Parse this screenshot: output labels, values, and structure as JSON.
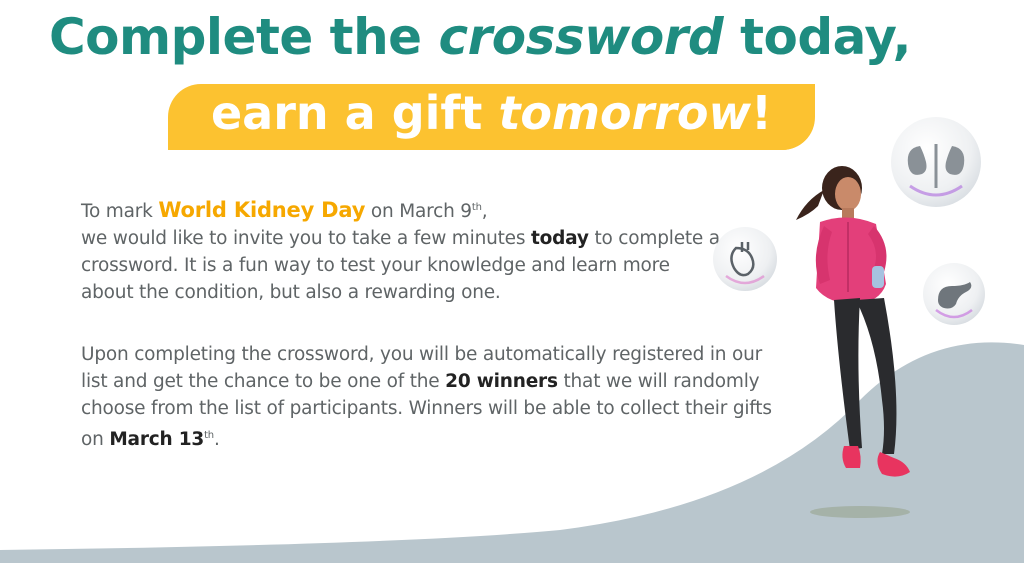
{
  "headline": {
    "line1_a": "Complete the ",
    "line1_b": "crossword",
    "line1_c": " today,",
    "line2_a": "earn a gift ",
    "line2_b": "tomorrow",
    "line2_c": "!"
  },
  "paragraph1": {
    "t1": "To mark ",
    "highlight": "World Kidney Day",
    "t2": " on March 9",
    "sup": "th",
    "t3": ",",
    "t4": "we would like to invite you to take a few minutes ",
    "bold": "today",
    "t5": " to complete a crossword. It is a fun way to test your knowledge and learn more about the condition, but also a rewarding one."
  },
  "paragraph2": {
    "t1": "Upon completing the crossword, you will be automatically registered in our list and get the chance to be one of the ",
    "bold1": "20 winners",
    "t2": " that we will randomly choose from the list of participants. Winners will be able to collect their gifts on ",
    "bold2": "March 13",
    "sup": "th",
    "t3": "."
  },
  "icons": [
    "kidneys-icon",
    "heart-icon",
    "pancreas-icon"
  ],
  "colors": {
    "title": "#1f8c80",
    "pill": "#fcc230",
    "highlight": "#f6a800",
    "hill": "#b9c6cd"
  }
}
